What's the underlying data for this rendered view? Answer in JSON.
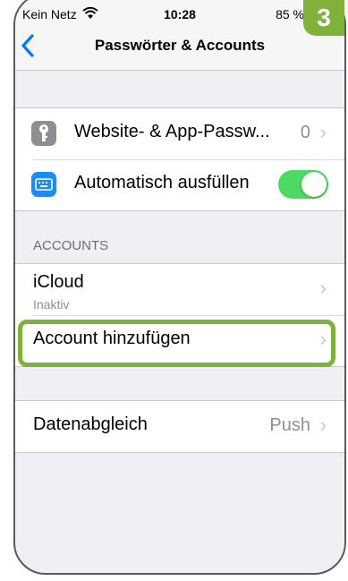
{
  "statusbar": {
    "carrier": "Kein Netz",
    "time": "10:28",
    "battery": "85 %"
  },
  "navbar": {
    "back_icon": "chevron-left-icon",
    "title": "Passwörter & Accounts"
  },
  "passwords_group": {
    "items": [
      {
        "label": "Website- & App-Passw...",
        "value": "0",
        "icon": "key-icon"
      },
      {
        "label": "Automatisch ausfüllen",
        "icon": "keyboard-icon",
        "toggle_on": true
      }
    ]
  },
  "accounts_section": {
    "header": "ACCOUNTS",
    "items": [
      {
        "label": "iCloud",
        "sublabel": "Inaktiv"
      },
      {
        "label": "Account hinzufügen"
      }
    ]
  },
  "sync_group": {
    "label": "Datenabgleich",
    "value": "Push"
  },
  "step_badge": "3",
  "colors": {
    "accent": "#007aff",
    "toggle_on": "#4cd964",
    "highlight": "#7fb13b"
  }
}
